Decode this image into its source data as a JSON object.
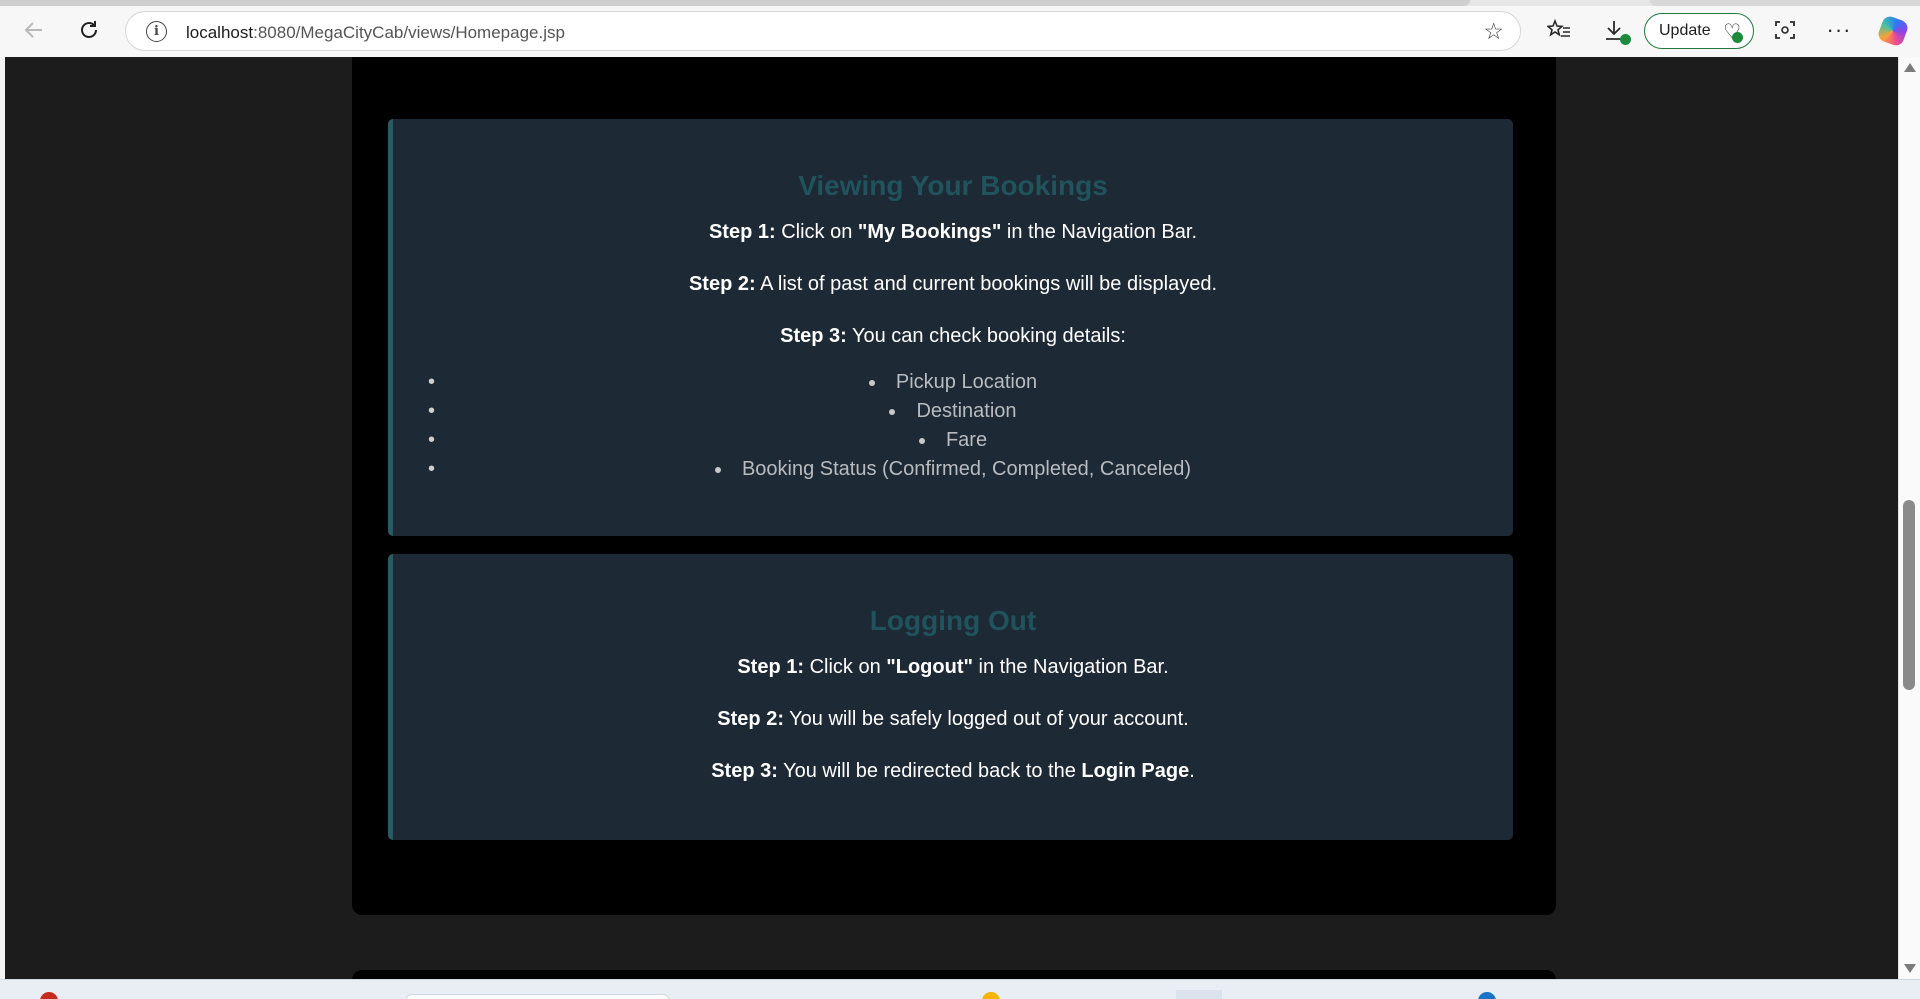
{
  "browser": {
    "url_host": "localhost",
    "url_path": ":8080/MegaCityCab/views/Homepage.jsp",
    "update_label": "Update"
  },
  "sections": [
    {
      "title": "Viewing Your Bookings",
      "steps": [
        {
          "label": "Step 1:",
          "before": " Click on ",
          "strong": "\"My Bookings\"",
          "after": " in the Navigation Bar."
        },
        {
          "label": "Step 2:",
          "text": " A list of past and current bookings will be displayed."
        },
        {
          "label": "Step 3:",
          "text": " You can check booking details:"
        }
      ],
      "details": [
        "Pickup Location",
        "Destination",
        "Fare",
        "Booking Status (Confirmed, Completed, Canceled)"
      ]
    },
    {
      "title": "Logging Out",
      "steps": [
        {
          "label": "Step 1:",
          "before": " Click on ",
          "strong": "\"Logout\"",
          "after": " in the Navigation Bar."
        },
        {
          "label": "Step 2:",
          "text": " You will be safely logged out of your account."
        },
        {
          "label": "Step 3:",
          "before": " You will be redirected back to the ",
          "strong": "Login Page",
          "after": "."
        }
      ]
    }
  ],
  "colors": {
    "page_bg": "#1c1c1c",
    "container_bg": "#000000",
    "card_bg": "#1d2934",
    "card_accent": "#2a5a66",
    "heading": "#21535d"
  },
  "icons": [
    "back-icon",
    "refresh-icon",
    "info-icon",
    "star-icon",
    "favorites-icon",
    "download-icon",
    "heart-monitor-icon",
    "screenshot-icon",
    "more-icon",
    "copilot-icon"
  ]
}
